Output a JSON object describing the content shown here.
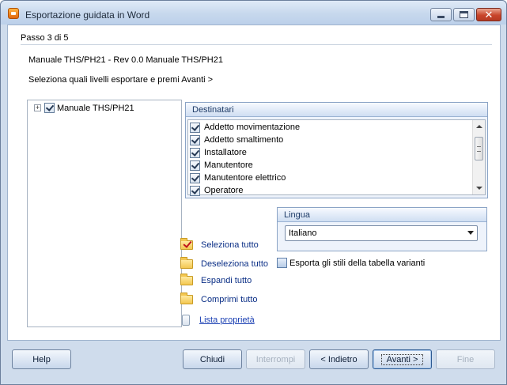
{
  "window": {
    "title": "Esportazione guidata in Word"
  },
  "step": "Passo 3 di 5",
  "document_name": "Manuale THS/PH21 - Rev 0.0 Manuale THS/PH21",
  "instruction": "Seleziona quali livelli esportare e premi Avanti >",
  "tree": {
    "root": {
      "label": "Manuale THS/PH21",
      "checked": true,
      "expander": "+"
    }
  },
  "destinatari": {
    "title": "Destinatari",
    "items": [
      {
        "label": "Addetto movimentazione",
        "checked": true
      },
      {
        "label": "Addetto smaltimento",
        "checked": true
      },
      {
        "label": "Installatore",
        "checked": true
      },
      {
        "label": "Manutentore",
        "checked": true
      },
      {
        "label": "Manutentore elettrico",
        "checked": true
      },
      {
        "label": "Operatore",
        "checked": true
      }
    ]
  },
  "lingua": {
    "title": "Lingua",
    "selected": "Italiano"
  },
  "actions": {
    "select_all": "Seleziona tutto",
    "deselect_all": "Deseleziona tutto",
    "expand_all": "Espandi tutto",
    "collapse_all": "Comprimi tutto",
    "properties_list": "Lista proprietà"
  },
  "export_styles": {
    "label": "Esporta gli stili della tabella varianti",
    "checked": false
  },
  "buttons": {
    "help": "Help",
    "close": "Chiudi",
    "interrupt": "Interrompi",
    "back": "< Indietro",
    "next": "Avanti >",
    "finish": "Fine"
  },
  "colors": {
    "link": "#1a3fb3",
    "action_text": "#0b2f86",
    "panel_header": "#1d3a66"
  }
}
